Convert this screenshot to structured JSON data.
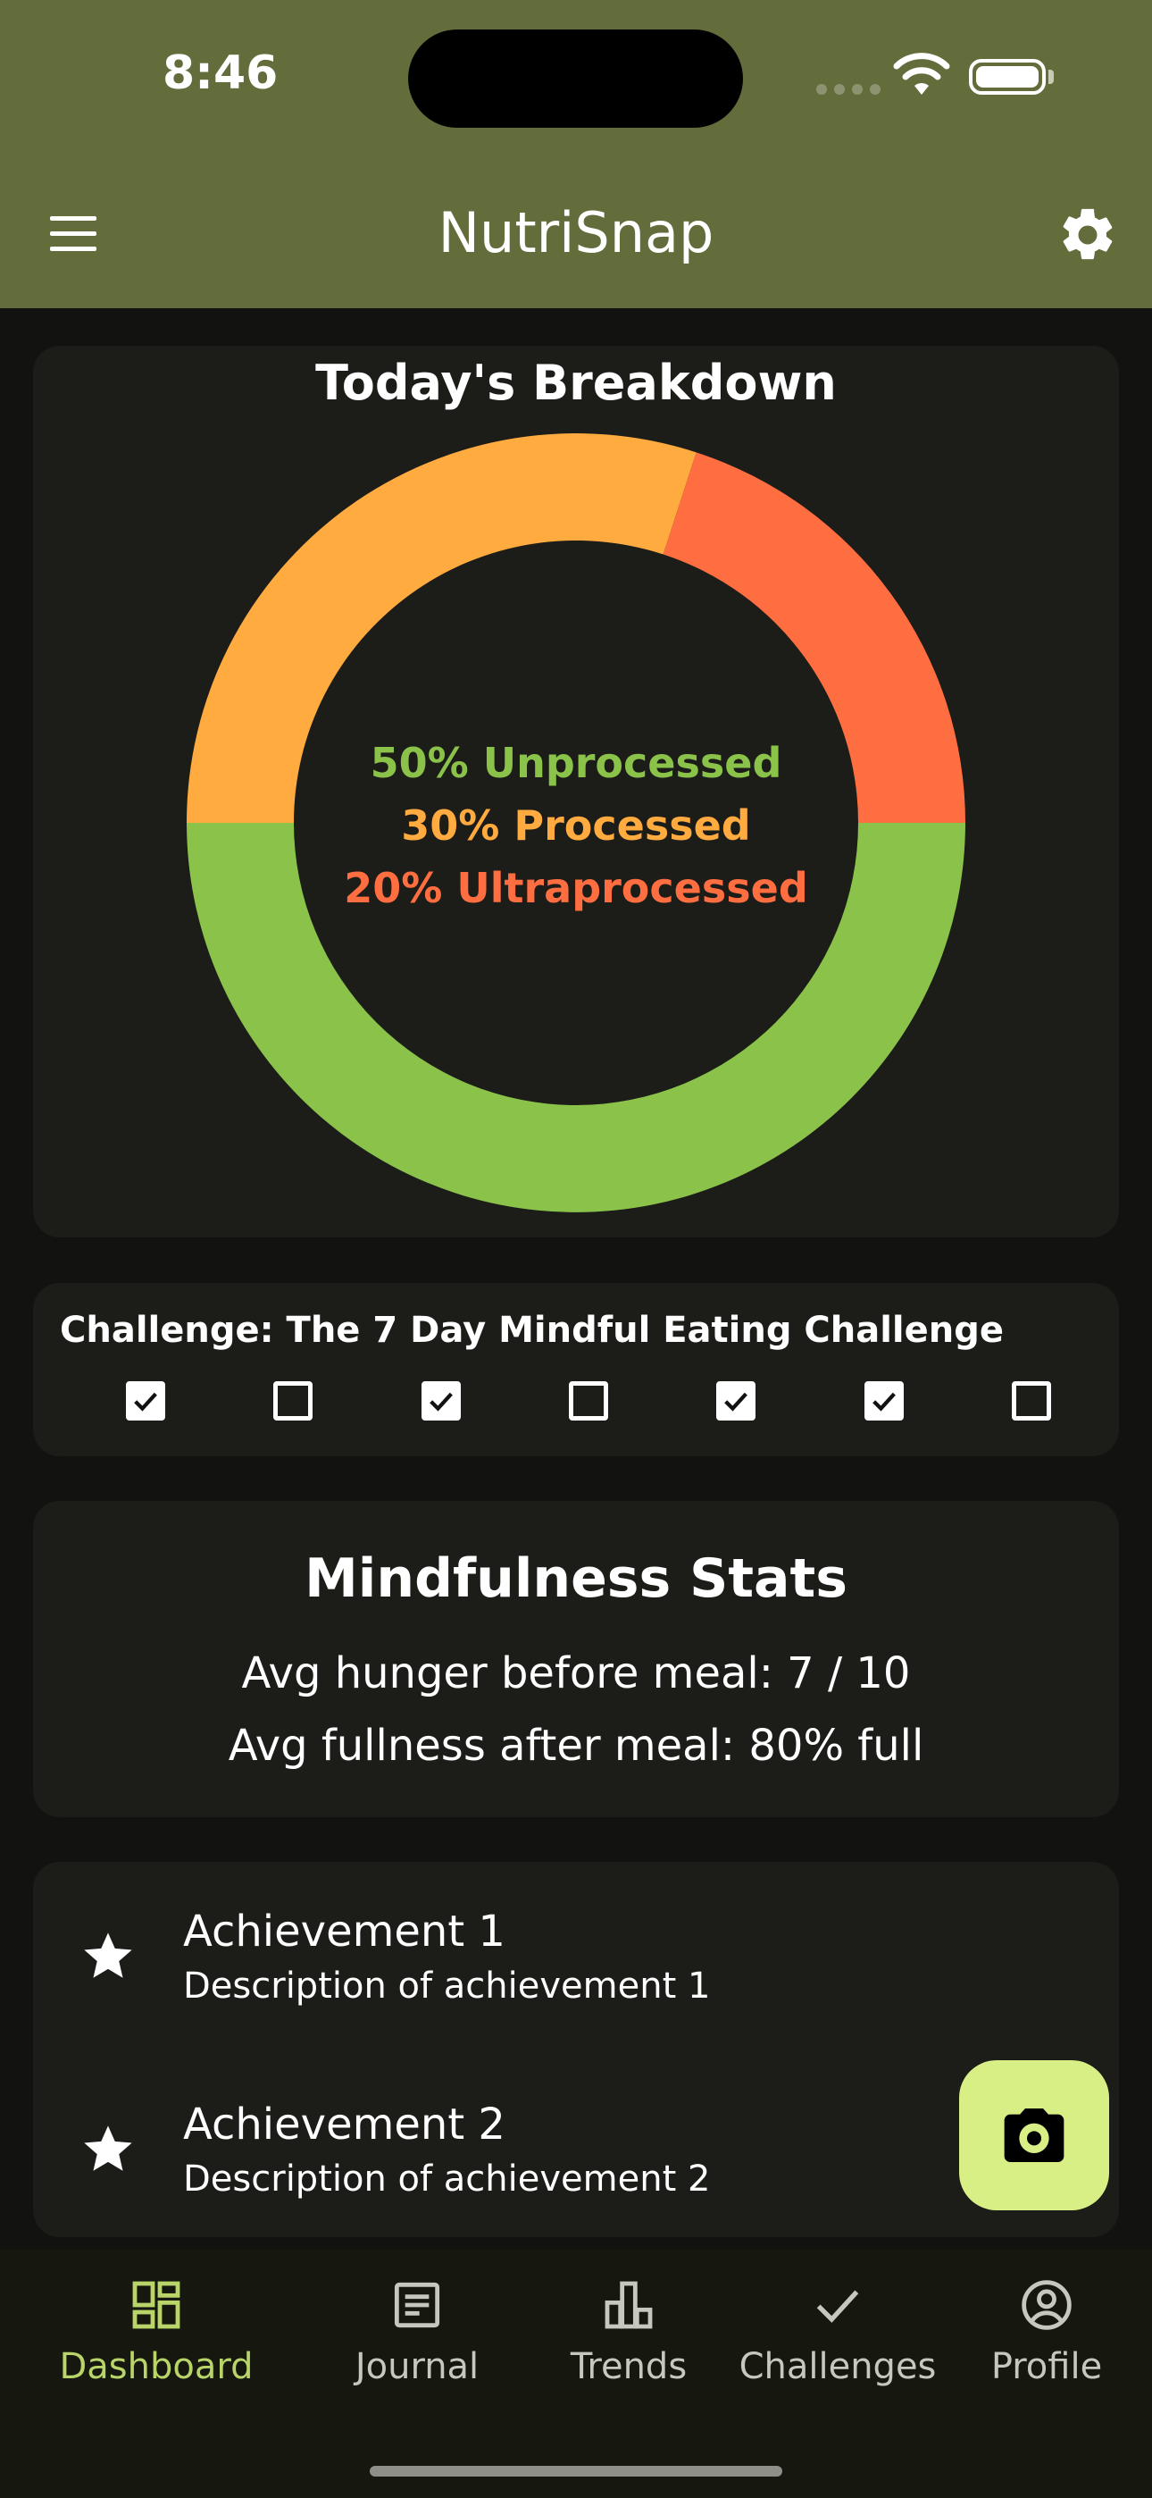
{
  "status_bar": {
    "time": "8:46"
  },
  "app_bar": {
    "title": "NutriSnap"
  },
  "breakdown": {
    "title": "Today's Breakdown",
    "center_lines": [
      {
        "text": "50% Unprocessed",
        "color": "#8bc34a"
      },
      {
        "text": "30% Processed",
        "color": "#ffab40"
      },
      {
        "text": "20% Ultraprocessed",
        "color": "#ff6e40"
      }
    ]
  },
  "chart_data": {
    "type": "pie",
    "donut": true,
    "categories": [
      "Unprocessed",
      "Processed",
      "Ultraprocessed"
    ],
    "values": [
      50,
      30,
      20
    ],
    "colors": [
      "#8bc34a",
      "#ffab40",
      "#ff6e40"
    ],
    "title": "Today's Breakdown"
  },
  "challenge": {
    "title": "Challenge: The 7 Day Mindful Eating Challenge",
    "days": [
      true,
      false,
      true,
      false,
      true,
      true,
      false
    ]
  },
  "stats": {
    "title": "Mindfulness Stats",
    "hunger": "Avg hunger before meal: 7 / 10",
    "fullness": "Avg fullness after meal: 80% full"
  },
  "achievements": [
    {
      "title": "Achievement 1",
      "description": "Description of achievement 1",
      "icon": "star-icon"
    },
    {
      "title": "Achievement 2",
      "description": "Description of achievement 2",
      "icon": "star-icon"
    }
  ],
  "fab": {
    "icon": "camera-icon"
  },
  "nav": {
    "items": [
      {
        "label": "Dashboard",
        "icon": "dashboard-icon",
        "active": true
      },
      {
        "label": "Journal",
        "icon": "journal-icon",
        "active": false
      },
      {
        "label": "Trends",
        "icon": "trends-icon",
        "active": false
      },
      {
        "label": "Challenges",
        "icon": "check-icon",
        "active": false
      },
      {
        "label": "Profile",
        "icon": "profile-icon",
        "active": false
      }
    ]
  },
  "colors": {
    "app_bar": "#636d3c",
    "accent": "#b9d56a",
    "fab": "#d8ef86"
  }
}
